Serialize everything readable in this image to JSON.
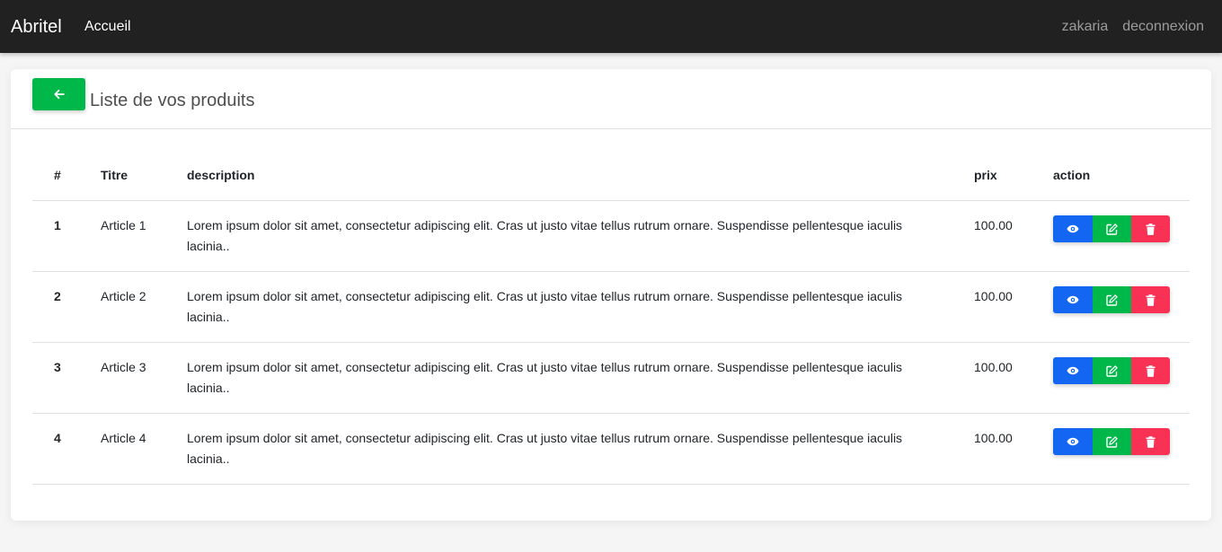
{
  "navbar": {
    "brand": "Abritel",
    "home": "Accueil",
    "user": "zakaria",
    "logout": "deconnexion"
  },
  "card": {
    "title": "Liste de vos produits"
  },
  "table": {
    "headers": [
      "#",
      "Titre",
      "description",
      "prix",
      "action"
    ],
    "rows": [
      {
        "num": "1",
        "title": "Article 1",
        "description": "Lorem ipsum dolor sit amet, consectetur adipiscing elit. Cras ut justo vitae tellus rutrum ornare. Suspendisse pellentesque iaculis lacinia..",
        "price": "100.00"
      },
      {
        "num": "2",
        "title": "Article 2",
        "description": "Lorem ipsum dolor sit amet, consectetur adipiscing elit. Cras ut justo vitae tellus rutrum ornare. Suspendisse pellentesque iaculis lacinia..",
        "price": "100.00"
      },
      {
        "num": "3",
        "title": "Article 3",
        "description": "Lorem ipsum dolor sit amet, consectetur adipiscing elit. Cras ut justo vitae tellus rutrum ornare. Suspendisse pellentesque iaculis lacinia..",
        "price": "100.00"
      },
      {
        "num": "4",
        "title": "Article 4",
        "description": "Lorem ipsum dolor sit amet, consectetur adipiscing elit. Cras ut justo vitae tellus rutrum ornare. Suspendisse pellentesque iaculis lacinia..",
        "price": "100.00"
      }
    ]
  },
  "icons": {
    "back": "arrow-left-icon",
    "view": "eye-icon",
    "edit": "edit-icon",
    "delete": "trash-icon"
  },
  "colors": {
    "navbar": "#212121",
    "success": "#00b74a",
    "primary": "#1266f1",
    "danger": "#f93154"
  }
}
